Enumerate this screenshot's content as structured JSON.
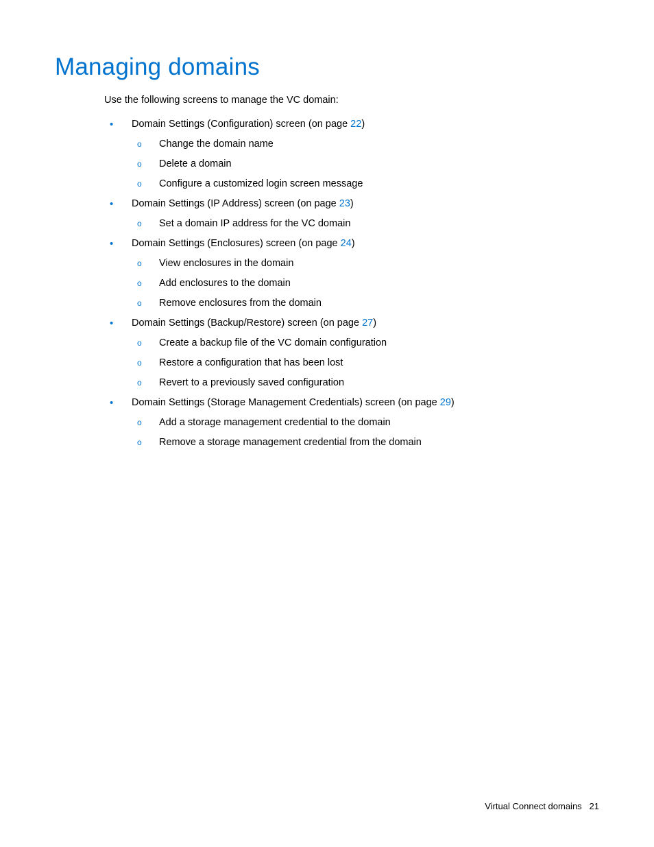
{
  "title": "Managing domains",
  "intro": "Use the following screens to manage the VC domain:",
  "sections": [
    {
      "text_before": "Domain Settings (Configuration) screen (on page ",
      "page_ref": "22",
      "text_after": ")",
      "subs": [
        "Change the domain name",
        "Delete a domain",
        "Configure a customized login screen message"
      ]
    },
    {
      "text_before": "Domain Settings (IP Address) screen (on page ",
      "page_ref": "23",
      "text_after": ")",
      "subs": [
        "Set a domain IP address for the VC domain"
      ]
    },
    {
      "text_before": "Domain Settings (Enclosures) screen (on page ",
      "page_ref": "24",
      "text_after": ")",
      "subs": [
        "View enclosures in the domain",
        "Add enclosures to the domain",
        "Remove enclosures from the domain"
      ]
    },
    {
      "text_before": "Domain Settings (Backup/Restore) screen (on page ",
      "page_ref": "27",
      "text_after": ")",
      "subs": [
        "Create a backup file of the VC domain configuration",
        "Restore a configuration that has been lost",
        "Revert to a previously saved configuration"
      ]
    },
    {
      "text_before": "Domain Settings (Storage Management Credentials) screen (on page ",
      "page_ref": "29",
      "text_after": ")",
      "subs": [
        "Add a storage management credential to the domain",
        "Remove a storage management credential from the domain"
      ]
    }
  ],
  "footer": {
    "section": "Virtual Connect domains",
    "page_number": "21"
  }
}
